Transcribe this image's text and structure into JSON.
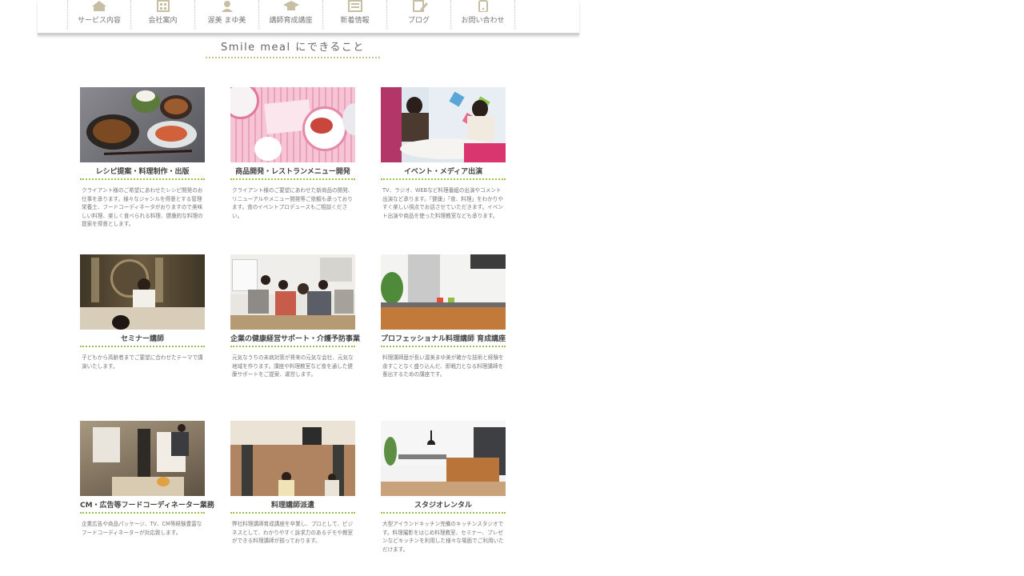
{
  "nav": {
    "items": [
      {
        "label": "サービス内容",
        "icon": "house-icon"
      },
      {
        "label": "会社案内",
        "icon": "building-icon"
      },
      {
        "label": "渥美 まゆ美",
        "icon": "person-icon"
      },
      {
        "label": "講師育成講座",
        "icon": "hat-icon"
      },
      {
        "label": "新着情報",
        "icon": "newspaper-icon"
      },
      {
        "label": "ブログ",
        "icon": "pencil-icon"
      },
      {
        "label": "お問い合わせ",
        "icon": "phone-icon"
      }
    ]
  },
  "section": {
    "title": "Smile meal にできること"
  },
  "cards": [
    {
      "title": "レシピ提案・料理制作・出版",
      "image": "food-plate-photo",
      "text": "クライアント様のご希望にあわせたレシピ開発のお仕事を承ります。様々なジャンルを得意とする管理栄養士、フードコーディネータがおりますので美味しい料理、楽しく食べられる料理、健康的な料理の提案を得意とします。"
    },
    {
      "title": "商品開発・レストランメニュー開発",
      "image": "pink-table-photo",
      "text": "クライアント様のご要望にあわせた新商品の開発、リニューアルやメニュー開発等ご依頼も承っております。食のイベントプロデュースもご相談ください。"
    },
    {
      "title": "イベント・メディア出演",
      "image": "tv-studio-photo",
      "text": "TV、ラジオ、WEBなど料理番組の出演やコメント出演など承ります。「健康」「食、料理」をわかりやすく楽しい視点でお話させていただきます。イベント出演や商品を使った料理教室なども承ります。"
    },
    {
      "title": "セミナー講師",
      "image": "seminar-photo",
      "text": "子どもから高齢者までご要望に合わせたテーマで講演いたします。"
    },
    {
      "title": "企業の健康経営サポート・介護予防事業",
      "image": "classroom-photo",
      "text": "元気なうちの未病対策が将来の元気な会社、元気な地域を作ります。講座や料理教室など食を通した健康サポートをご提案、運営します。"
    },
    {
      "title": "プロフェッショナル料理講師 育成講座",
      "image": "kitchen-photo",
      "text": "料理講師歴が長い渥美まゆ美が確かな技術と経験を余すことなく盛り込んだ、即戦力となる料理講師を輩出するための講座です。"
    },
    {
      "title": "CM・広告等フードコーディネーター業務",
      "image": "photo-shoot-photo",
      "text": "企業広告や商品パッケージ、TV、CM等経験豊富なフードコーディネーターが対応致します。"
    },
    {
      "title": "料理講師派遣",
      "image": "cooking-class-photo",
      "text": "弊社料理講師育成講座を卒業し、プロとして、ビジネスとして、わかりやすく訴求力のあるデモや教室ができる料理講師が揃っております。"
    },
    {
      "title": "スタジオレンタル",
      "image": "studio-photo",
      "text": "大型アイランドキッチン完備のキッチンスタジオです。料理撮影をはじめ料理教室、セミナー、プレゼンなどキッチンを利用した様々な場面でご利用いただけます。"
    }
  ],
  "colors": {
    "accent_green": "#9bc24a",
    "nav_border": "#cfcfcf",
    "heading_rule": "#c9c28a"
  }
}
